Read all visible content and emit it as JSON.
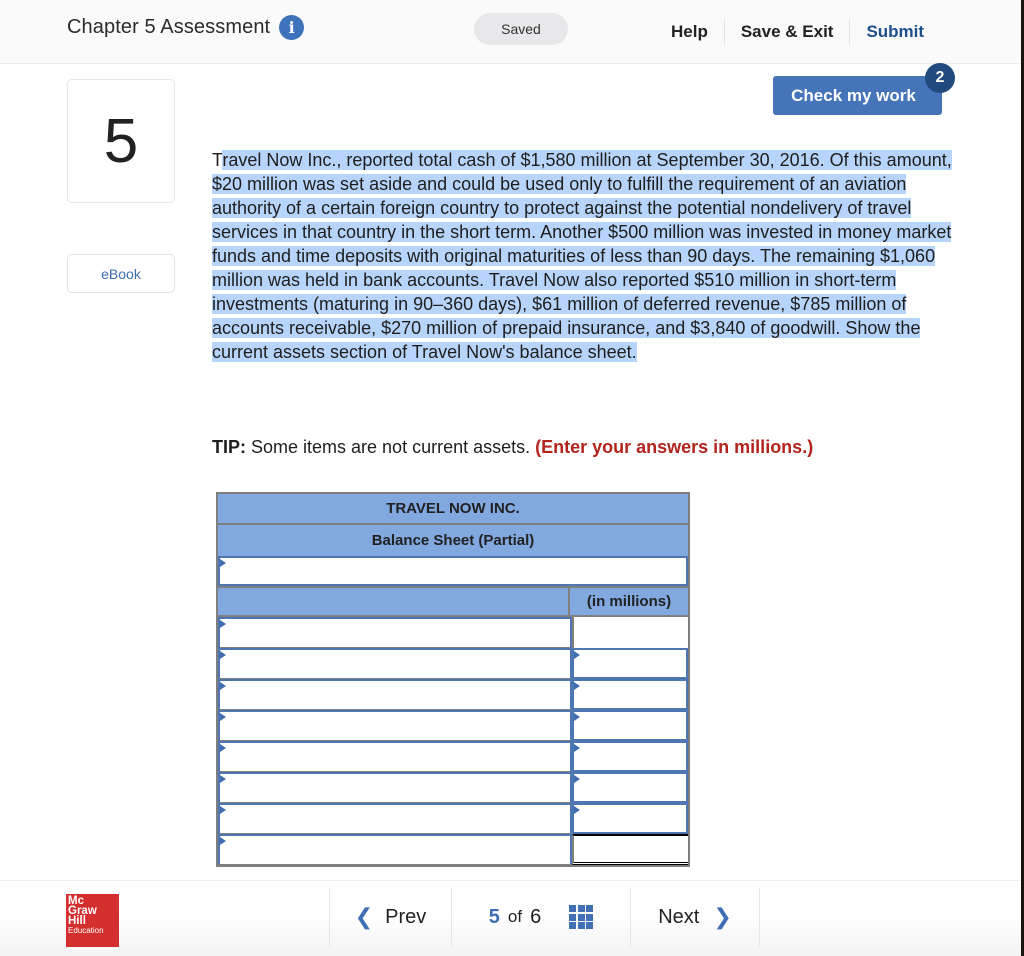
{
  "header": {
    "title": "Chapter 5 Assessment",
    "info_icon": "info-icon",
    "saved_status": "Saved",
    "nav": {
      "help": "Help",
      "save_exit": "Save & Exit",
      "submit": "Submit"
    }
  },
  "check_work": {
    "label": "Check my work",
    "badge_count": "2"
  },
  "sidebar": {
    "question_number": "5",
    "ebook_label": "eBook"
  },
  "question": {
    "first_chars": "T",
    "text": "ravel Now Inc., reported total cash of $1,580 million at September 30, 2016. Of this amount, $20 million was set aside and could be used only to fulfill the requirement of an aviation authority of a certain foreign country to protect against the potential nondelivery of travel services in that country in the short term. Another $500 million was invested in money market funds and time deposits with original maturities of less than 90 days. The remaining $1,060 million was held in bank accounts. Travel Now also reported $510 million in short-term investments (maturing in 90–360 days), $61 million of deferred revenue, $785 million of accounts receivable, $270 million of prepaid insurance, and $3,840 of goodwill. Show the current assets section of Travel Now's balance sheet."
  },
  "tip": {
    "label": "TIP:",
    "text": " Some items are not current assets. ",
    "emphasis": "(Enter your answers in millions.)"
  },
  "balance_sheet": {
    "company": "TRAVEL NOW INC.",
    "statement": "Balance Sheet (Partial)",
    "column_header": "(in millions)",
    "section_input": "",
    "rows": [
      {
        "label": "",
        "value": null,
        "value_input": false
      },
      {
        "label": "",
        "value": "",
        "value_input": true
      },
      {
        "label": "",
        "value": "",
        "value_input": true
      },
      {
        "label": "",
        "value": "",
        "value_input": true
      },
      {
        "label": "",
        "value": "",
        "value_input": true
      },
      {
        "label": "",
        "value": "",
        "value_input": true
      },
      {
        "label": "",
        "value": "",
        "value_input": true
      },
      {
        "label": "",
        "value": "",
        "value_input": false,
        "total": true
      }
    ]
  },
  "footer": {
    "logo": {
      "line1": "Mc",
      "line2": "Graw",
      "line3": "Hill",
      "line4": "Education"
    },
    "prev_label": "Prev",
    "current_page": "5",
    "of_label": "of",
    "total_pages": "6",
    "next_label": "Next"
  }
}
